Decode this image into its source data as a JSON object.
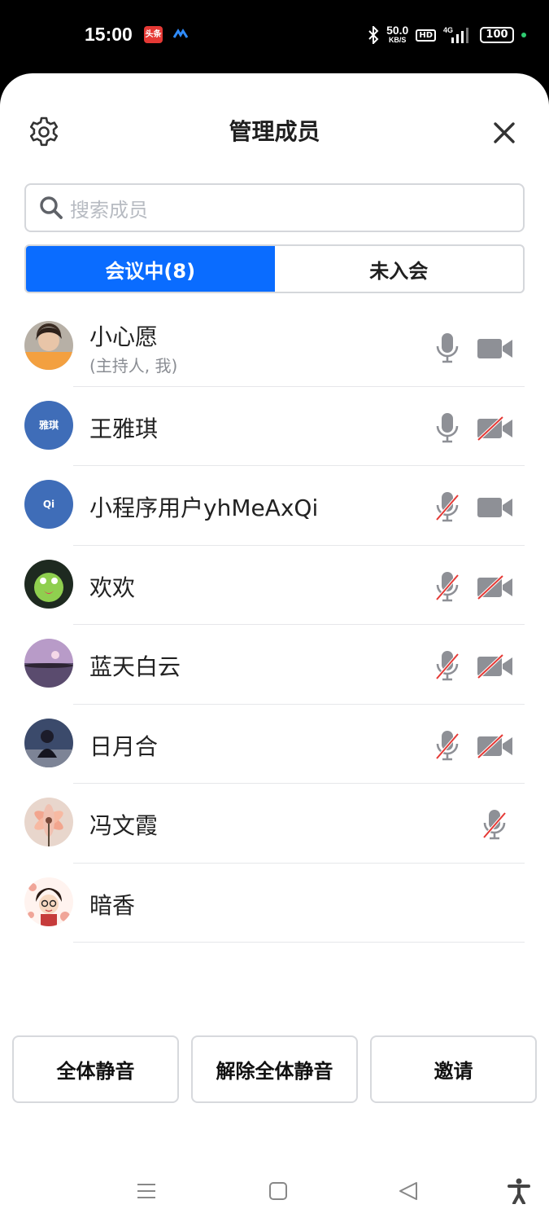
{
  "status_bar": {
    "time": "15:00",
    "app_badge": "头条",
    "net_speed": "50.0",
    "net_unit": "KB/S",
    "hd": "HD",
    "network": "4G",
    "battery": "100"
  },
  "header": {
    "title": "管理成员",
    "icons": {
      "left": "gear-icon",
      "right": "close-icon"
    }
  },
  "search": {
    "placeholder": "搜索成员"
  },
  "tabs": [
    {
      "label": "会议中(8)",
      "active": true
    },
    {
      "label": "未入会",
      "active": false
    }
  ],
  "members": [
    {
      "name": "小心愿",
      "subtitle": "(主持人, 我)",
      "avatar_text": "",
      "mic_on": true,
      "cam_on": true
    },
    {
      "name": "王雅琪",
      "subtitle": "",
      "avatar_text": "雅琪",
      "mic_on": true,
      "cam_on": false
    },
    {
      "name": "小程序用户yhMeAxQi",
      "subtitle": "",
      "avatar_text": "Qi",
      "mic_on": false,
      "cam_on": true
    },
    {
      "name": "欢欢",
      "subtitle": "",
      "avatar_text": "",
      "mic_on": false,
      "cam_on": false
    },
    {
      "name": "蓝天白云",
      "subtitle": "",
      "avatar_text": "",
      "mic_on": false,
      "cam_on": false
    },
    {
      "name": "日月合",
      "subtitle": "",
      "avatar_text": "",
      "mic_on": false,
      "cam_on": false
    },
    {
      "name": "冯文霞",
      "subtitle": "",
      "avatar_text": "",
      "mic_on": false,
      "cam_on": null
    },
    {
      "name": "暗香",
      "subtitle": "",
      "avatar_text": "",
      "mic_on": null,
      "cam_on": null
    }
  ],
  "actions": {
    "mute_all": "全体静音",
    "unmute_all": "解除全体静音",
    "invite": "邀请"
  },
  "colors": {
    "accent": "#0a6cff",
    "icon_gray": "#8e9096",
    "strike_red": "#e53935"
  }
}
